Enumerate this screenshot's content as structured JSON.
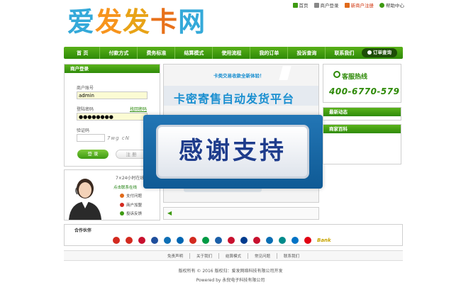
{
  "topbar": {
    "links": [
      {
        "label": "首页",
        "color": "#444444"
      },
      {
        "label": "商户登录",
        "color": "#444444"
      },
      {
        "label": "新商户注册",
        "color": "#d0320a"
      },
      {
        "label": "帮助中心",
        "color": "#444444"
      }
    ]
  },
  "logo": {
    "chars": [
      "爱",
      "发",
      "发",
      "卡",
      "网"
    ]
  },
  "nav": {
    "items": [
      "首 页",
      "付款方式",
      "费务标准",
      "结算模式",
      "使用流程",
      "我的订单",
      "投诉查询",
      "联系我们"
    ],
    "order_button": "订单查询"
  },
  "login": {
    "title": "商户登录",
    "account_label": "商户账号",
    "account_value": "admin",
    "password_label": "登陆密码",
    "password_value": "●●●●●●●●",
    "forgot_label": "找回密码",
    "captcha_label": "验证码",
    "captcha_value": "",
    "captcha_image_text": "7wg cN",
    "login_button": "登 录",
    "register_button": "注 册"
  },
  "support": {
    "title": "7×24小时在线",
    "subtitle": "点击联系在线",
    "items": [
      "支付问题",
      "商户加盟",
      "投诉反馈"
    ]
  },
  "banner": {
    "tagline": "卡类交易收款全新体验！",
    "headline": "卡密寄售自动发货平台"
  },
  "overlay": {
    "text": "感谢支持"
  },
  "hotline": {
    "title": "客服热线",
    "number": "400-6770-579"
  },
  "sidebar": {
    "news_title": "最新动态",
    "wiki_title": "商家百科"
  },
  "partners": {
    "title": "合作伙伴",
    "logo_colors": [
      "#d32a1f",
      "#d32a1f",
      "#c8102e",
      "#1f4e9c",
      "#0e6fb5",
      "#0066b3",
      "#d32a1f",
      "#009a44",
      "#1a5fa8",
      "#c8102e",
      "#003b8e",
      "#c8102e",
      "#0a6eb4",
      "#008b8b",
      "#0073c6",
      "#e10012"
    ],
    "bank_label": "Bank"
  },
  "footer": {
    "links": [
      "免责声明",
      "关于我们",
      "结算模式",
      "常见问题",
      "联系我们"
    ],
    "copyright": "版权所有 © 2016 版权归：爱发网络科技有限公司开发",
    "powered": "Powered by 永倪电子科技有限公司"
  },
  "colors": {
    "brand_green": "#2e8a08",
    "brand_blue": "#1a8fd0",
    "overlay_blue": "#0f5a95"
  }
}
